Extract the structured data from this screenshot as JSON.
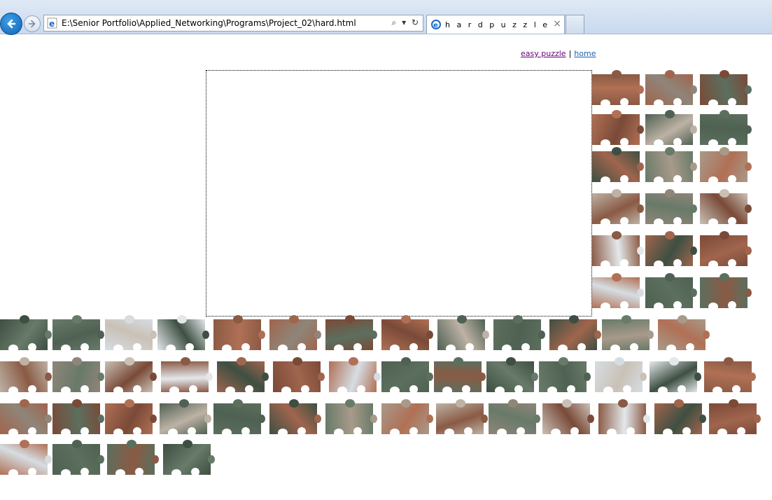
{
  "browser": {
    "address": "E:\\Senior Portfolio\\Applied_Networking\\Programs\\Project_02\\hard.html",
    "tab_title": "h a r d p u z z l e",
    "tab_close": "×"
  },
  "nav": {
    "easy_label": "easy puzzle",
    "separator": "|",
    "home_label": "home"
  },
  "palette": {
    "brick": [
      "#8a5a44",
      "#a0654d",
      "#7a4a38",
      "#b07055"
    ],
    "green": [
      "#4f6152",
      "#5c6f5e",
      "#3e4f42",
      "#687a69"
    ],
    "stone": [
      "#a89a8a",
      "#bdb2a5",
      "#8f8579",
      "#c9c1b6"
    ],
    "sky": [
      "#d6dde2",
      "#e4e8eb"
    ]
  }
}
